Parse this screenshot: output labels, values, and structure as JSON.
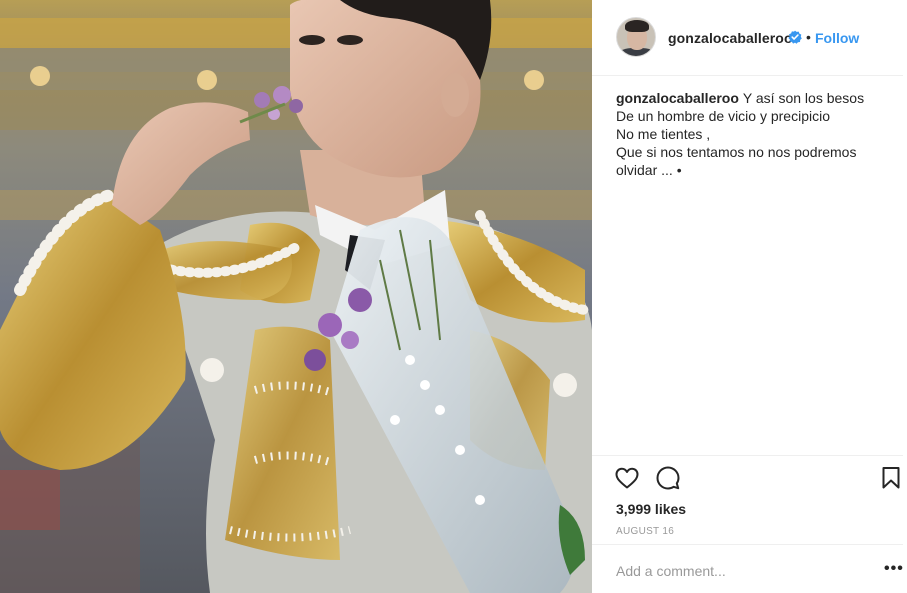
{
  "post": {
    "username": "gonzalocaballeroo",
    "verified_badge": "verified-icon",
    "separator": "•",
    "follow_label": "Follow",
    "caption": {
      "username": "gonzalocaballeroo",
      "lines": [
        "Y así son los besos",
        "De un hombre de vicio y precipicio",
        "No me tientes ,",
        "Que si nos tentamos no nos podremos",
        "olvidar ... •"
      ]
    },
    "likes": "3,999 likes",
    "date": "AUGUST 16",
    "comment_placeholder": "Add a comment...",
    "more_label": "•••"
  },
  "icons": {
    "like": "heart-icon",
    "comment": "comment-icon",
    "save": "bookmark-icon",
    "more": "more-options-icon"
  },
  "colors": {
    "link_blue": "#3897f0",
    "text": "#262626",
    "muted": "#999999",
    "divider": "#efefef"
  }
}
